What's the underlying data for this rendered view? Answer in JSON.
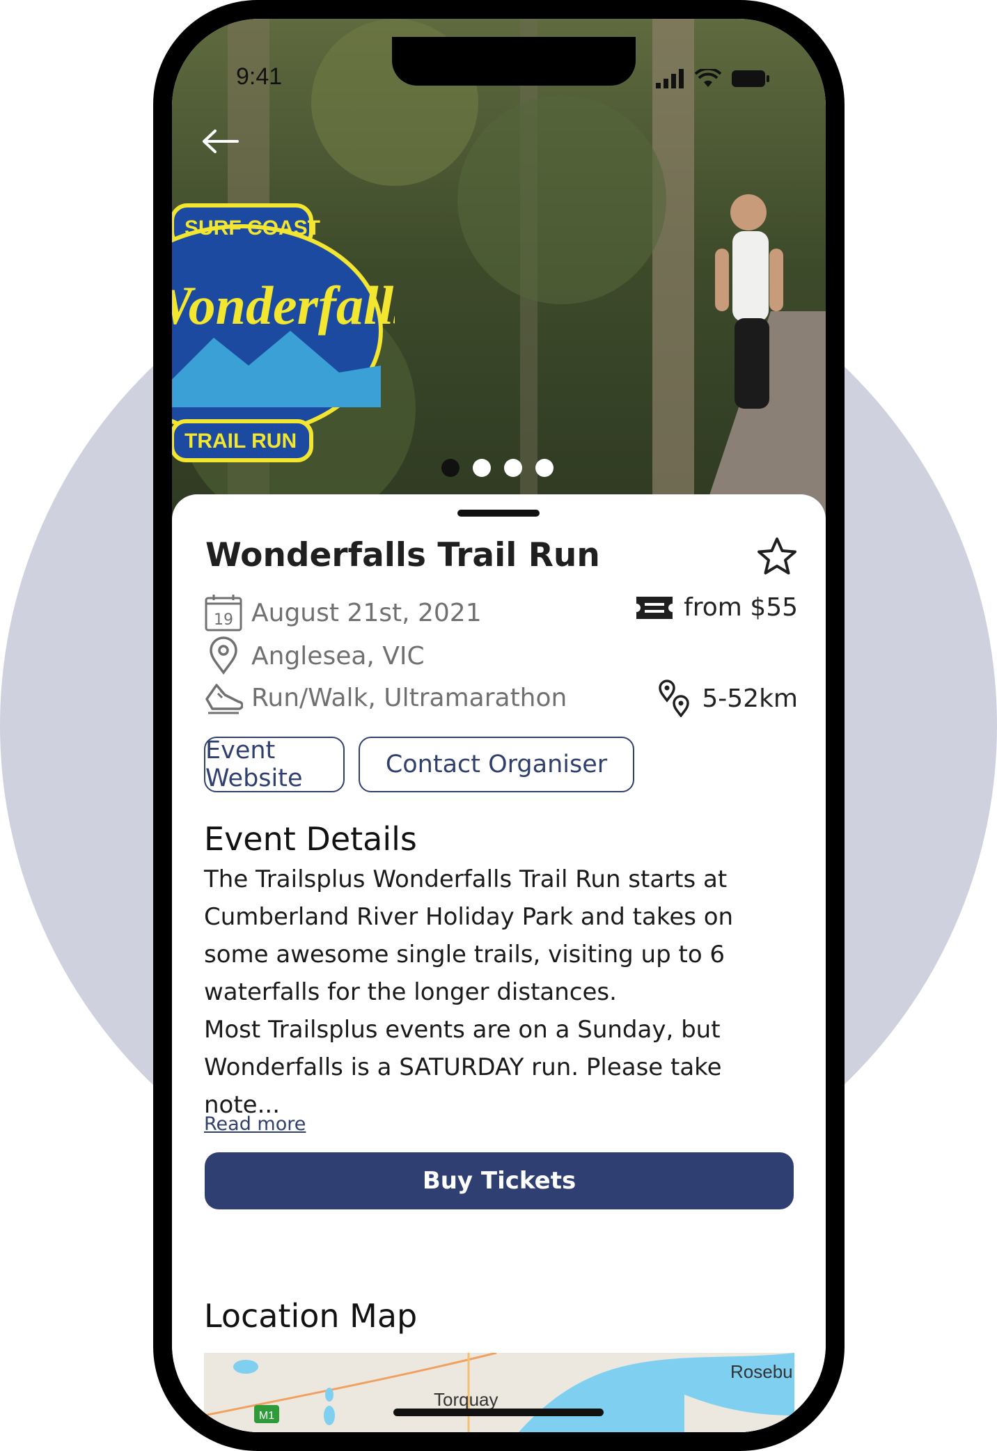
{
  "status_bar": {
    "time": "9:41"
  },
  "hero": {
    "logo_text_top": "SURF COAST",
    "logo_text_main": "Wonderfalls",
    "logo_text_bottom": "TRAIL RUN",
    "carousel_count": 4,
    "carousel_active": 1
  },
  "event": {
    "title": "Wonderfalls Trail Run",
    "calendar_day": "19",
    "date": "August 21st, 2021",
    "price": "from $55",
    "location": "Anglesea, VIC",
    "categories": "Run/Walk, Ultramarathon",
    "distance": "5-52km"
  },
  "buttons": {
    "website": "Event Website",
    "contact": "Contact Organiser",
    "buy": "Buy Tickets"
  },
  "details": {
    "heading": "Event Details",
    "para1": "The Trailsplus Wonderfalls Trail Run starts at Cumberland River Holiday Park and takes on some awesome single trails, visiting up to 6 waterfalls for the longer distances.",
    "para2": "Most Trailsplus events are on a Sunday, but Wonderfalls is a SATURDAY run. Please take note...",
    "read_more": "Read more"
  },
  "map": {
    "heading": "Location Map",
    "label_torquay": "Torquay",
    "label_rosebud": "Rosebu",
    "road_label": "M1"
  },
  "colors": {
    "accent": "#2f3f72",
    "background_circle": "#cfd2de"
  }
}
